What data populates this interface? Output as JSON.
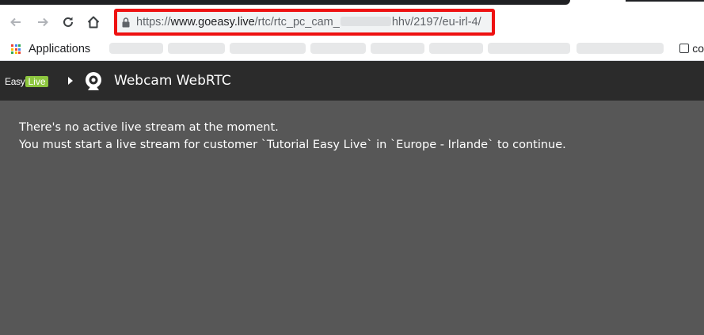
{
  "browser": {
    "url": {
      "scheme": "https://",
      "host": "www.goeasy.live",
      "path_start": "/rtc/rtc_pc_cam_",
      "path_end": "hhv/2197/eu-irl-4/"
    },
    "bookmarks": {
      "apps_label": "Applications",
      "trailing_label": "co"
    },
    "colors": {
      "url_highlight": "#ee1111"
    }
  },
  "app": {
    "logo": {
      "easy": "Easy",
      "live": "Live"
    },
    "title": "Webcam WebRTC",
    "colors": {
      "header_bg": "#2b2b2b",
      "content_bg": "#575757",
      "logo_green": "#8dc63f"
    }
  },
  "message": {
    "line1": "There's no active live stream at the moment.",
    "line2": "You must start a live stream for customer `Tutorial Easy Live` in `Europe - Irlande` to continue."
  },
  "icons": [
    "back-arrow-icon",
    "forward-arrow-icon",
    "reload-icon",
    "home-icon",
    "lock-icon",
    "apps-grid-icon",
    "webcam-icon",
    "caret-right-icon"
  ]
}
